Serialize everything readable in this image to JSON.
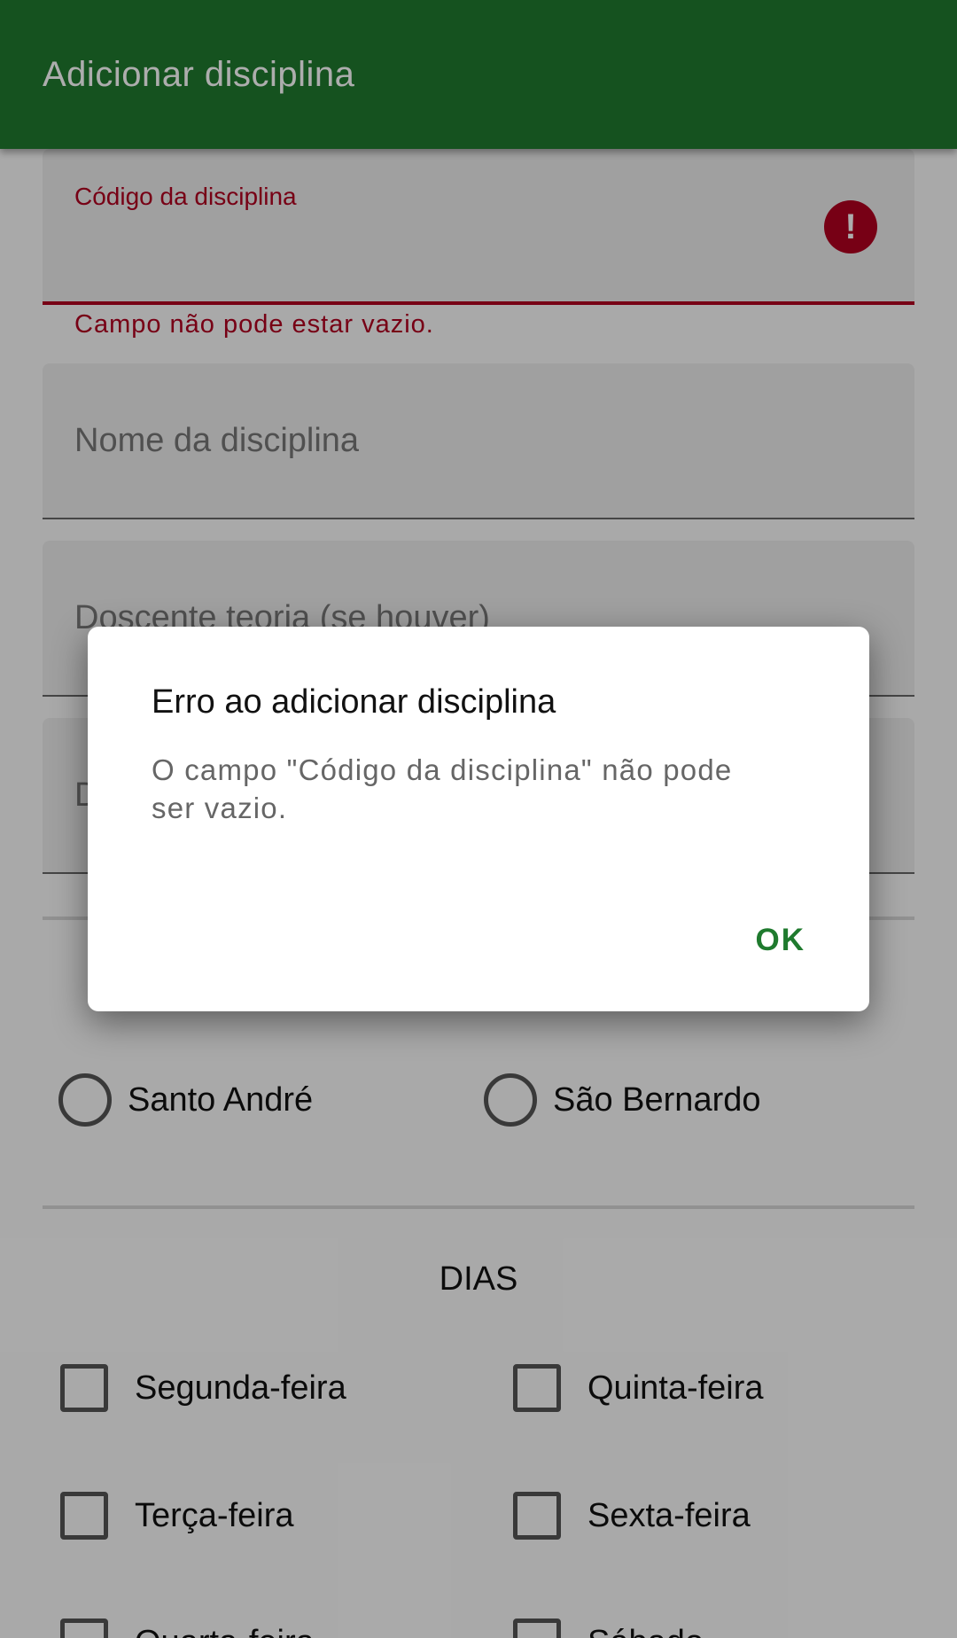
{
  "appbar": {
    "title": "Adicionar disciplina"
  },
  "form": {
    "codigo": {
      "label": "Código da disciplina",
      "error": "Campo não pode estar vazio."
    },
    "nome": {
      "placeholder": "Nome da disciplina"
    },
    "docente_teoria": {
      "placeholder": "Doscente teoria (se houver)"
    },
    "docente_pratica": {
      "placeholder": "D"
    },
    "campus": {
      "options": [
        "Santo André",
        "São Bernardo"
      ]
    },
    "dias": {
      "title": "DIAS",
      "days": [
        "Segunda-feira",
        "Quinta-feira",
        "Terça-feira",
        "Sexta-feira",
        "Quarta-feira",
        "Sábado"
      ]
    }
  },
  "dialog": {
    "title": "Erro ao adicionar disciplina",
    "message": "O campo \"Código da disciplina\" não pode ser vazio.",
    "ok_label": "OK"
  },
  "colors": {
    "primary": "#1f7a2e",
    "error": "#b00020"
  }
}
